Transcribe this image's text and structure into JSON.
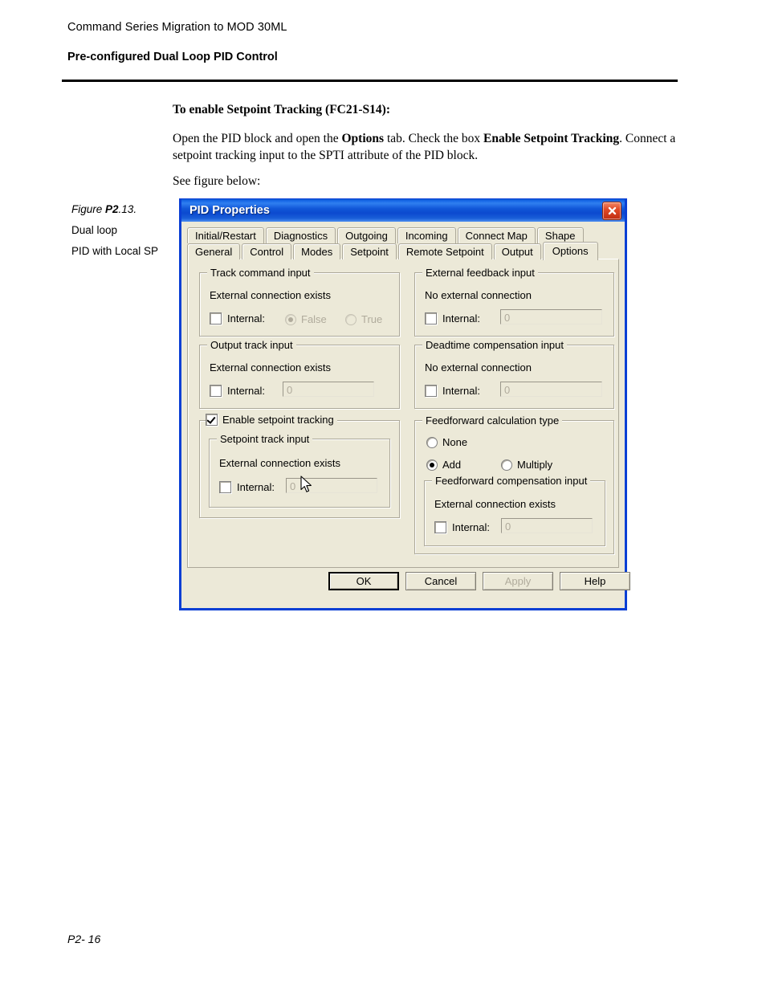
{
  "page": {
    "header_line1": "Command Series Migration to MOD 30ML",
    "header_line2": "Pre-configured Dual Loop PID Control",
    "heading": "To enable Setpoint Tracking (FC21-S14):",
    "para_part1": "Open the PID block and open the ",
    "para_bold1": "Options",
    "para_part2": " tab. Check the box ",
    "para_bold2": "Enable Setpoint Tracking",
    "para_part3": ". Connect a setpoint tracking input to the SPTI attribute of the PID block.",
    "see_figure": "See figure below:",
    "footer": "P2- 16"
  },
  "figure_caption": {
    "line1_prefix": "Figure ",
    "line1_bold": "P2",
    "line1_suffix": ".13.",
    "line2": "Dual loop",
    "line3": "PID with Local SP"
  },
  "dialog": {
    "title": "PID Properties",
    "close_icon": "close-icon",
    "tabs_row1": [
      {
        "label": "Initial/Restart",
        "selected": false
      },
      {
        "label": "Diagnostics",
        "selected": false
      },
      {
        "label": "Outgoing",
        "selected": false
      },
      {
        "label": "Incoming",
        "selected": false
      },
      {
        "label": "Connect Map",
        "selected": false
      },
      {
        "label": "Shape",
        "selected": false
      }
    ],
    "tabs_row2": [
      {
        "label": "General",
        "selected": false
      },
      {
        "label": "Control",
        "selected": false
      },
      {
        "label": "Modes",
        "selected": false
      },
      {
        "label": "Setpoint",
        "selected": false
      },
      {
        "label": "Remote Setpoint",
        "selected": false
      },
      {
        "label": "Output",
        "selected": false
      },
      {
        "label": "Options",
        "selected": true
      }
    ],
    "groups": {
      "track_command": {
        "title": "Track command input",
        "status": "External connection exists",
        "internal_label": "Internal:",
        "internal_checked": false,
        "radio_false": "False",
        "radio_true": "True",
        "radio_selected": "False",
        "radios_disabled": true
      },
      "external_feedback": {
        "title": "External feedback input",
        "status": "No external connection",
        "internal_label": "Internal:",
        "internal_checked": false,
        "field_value": "0",
        "field_disabled": true
      },
      "output_track": {
        "title": "Output track input",
        "status": "External connection exists",
        "internal_label": "Internal:",
        "internal_checked": false,
        "field_value": "0",
        "field_disabled": true
      },
      "deadtime_compensation": {
        "title": "Deadtime compensation input",
        "status": "No external connection",
        "internal_label": "Internal:",
        "internal_checked": false,
        "field_value": "0",
        "field_disabled": true
      },
      "enable_setpoint_tracking": {
        "title": "Enable setpoint tracking",
        "checked": true,
        "inner_title": "Setpoint track input",
        "status": "External connection exists",
        "internal_label": "Internal:",
        "internal_checked": false,
        "field_value": "0",
        "field_disabled": true
      },
      "feedforward": {
        "title": "Feedforward calculation type",
        "option_none": "None",
        "option_add": "Add",
        "option_multiply": "Multiply",
        "selected_option": "Add",
        "inner_title": "Feedforward compensation input",
        "status": "External connection exists",
        "internal_label": "Internal:",
        "internal_checked": false,
        "field_value": "0",
        "field_disabled": true
      }
    },
    "buttons": {
      "ok": "OK",
      "cancel": "Cancel",
      "apply": "Apply",
      "apply_disabled": true,
      "help": "Help"
    }
  },
  "colors": {
    "titlebar_blue": "#0a58d6",
    "dialog_face": "#ece9d8",
    "border_frame": "#0a3fd4",
    "close_red": "#e14b28",
    "disabled_text": "#b0ab9c"
  }
}
